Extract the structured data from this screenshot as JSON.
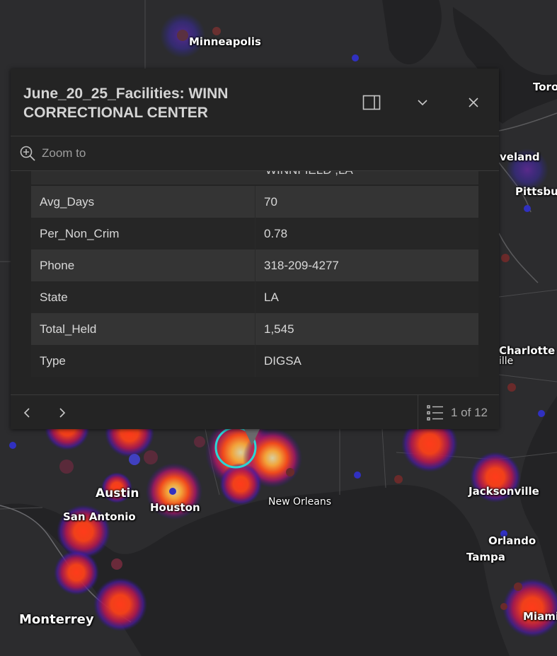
{
  "map": {
    "cities": [
      {
        "name": "Minneapolis",
        "key": "minneapolis"
      },
      {
        "name": "Toro",
        "key": "toro"
      },
      {
        "name": "veland",
        "key": "cleveland"
      },
      {
        "name": "Pittsbu",
        "key": "pittsburgh"
      },
      {
        "name": "Charlotte",
        "key": "charlotte"
      },
      {
        "name": "ille",
        "key": "ille"
      },
      {
        "name": "Austin",
        "key": "austin"
      },
      {
        "name": "Houston",
        "key": "houston"
      },
      {
        "name": "San Antonio",
        "key": "san-antonio"
      },
      {
        "name": "New Orleans",
        "key": "new-orleans"
      },
      {
        "name": "Jacksonville",
        "key": "jacksonville"
      },
      {
        "name": "Orlando",
        "key": "orlando"
      },
      {
        "name": "Tampa",
        "key": "tampa"
      },
      {
        "name": "Monterrey",
        "key": "monterrey"
      },
      {
        "name": "Miami",
        "key": "miami"
      }
    ]
  },
  "popup": {
    "title": "June_20_25_Facilities: WINN CORRECTIONAL CENTER",
    "dock_icon": "dock-side-icon",
    "collapse_icon": "chevron-down-icon",
    "close_icon": "close-icon",
    "zoom_label": "Zoom to",
    "partial_value": "WINNFIELD ,LA",
    "rows": [
      {
        "key": "Avg_Days",
        "value": "70"
      },
      {
        "key": "Per_Non_Crim",
        "value": "0.78"
      },
      {
        "key": "Phone",
        "value": "318-209-4277"
      },
      {
        "key": "State",
        "value": "LA"
      },
      {
        "key": "Total_Held",
        "value": "1,545"
      },
      {
        "key": "Type",
        "value": "DIGSA"
      }
    ],
    "pager_text": "1 of 12"
  }
}
